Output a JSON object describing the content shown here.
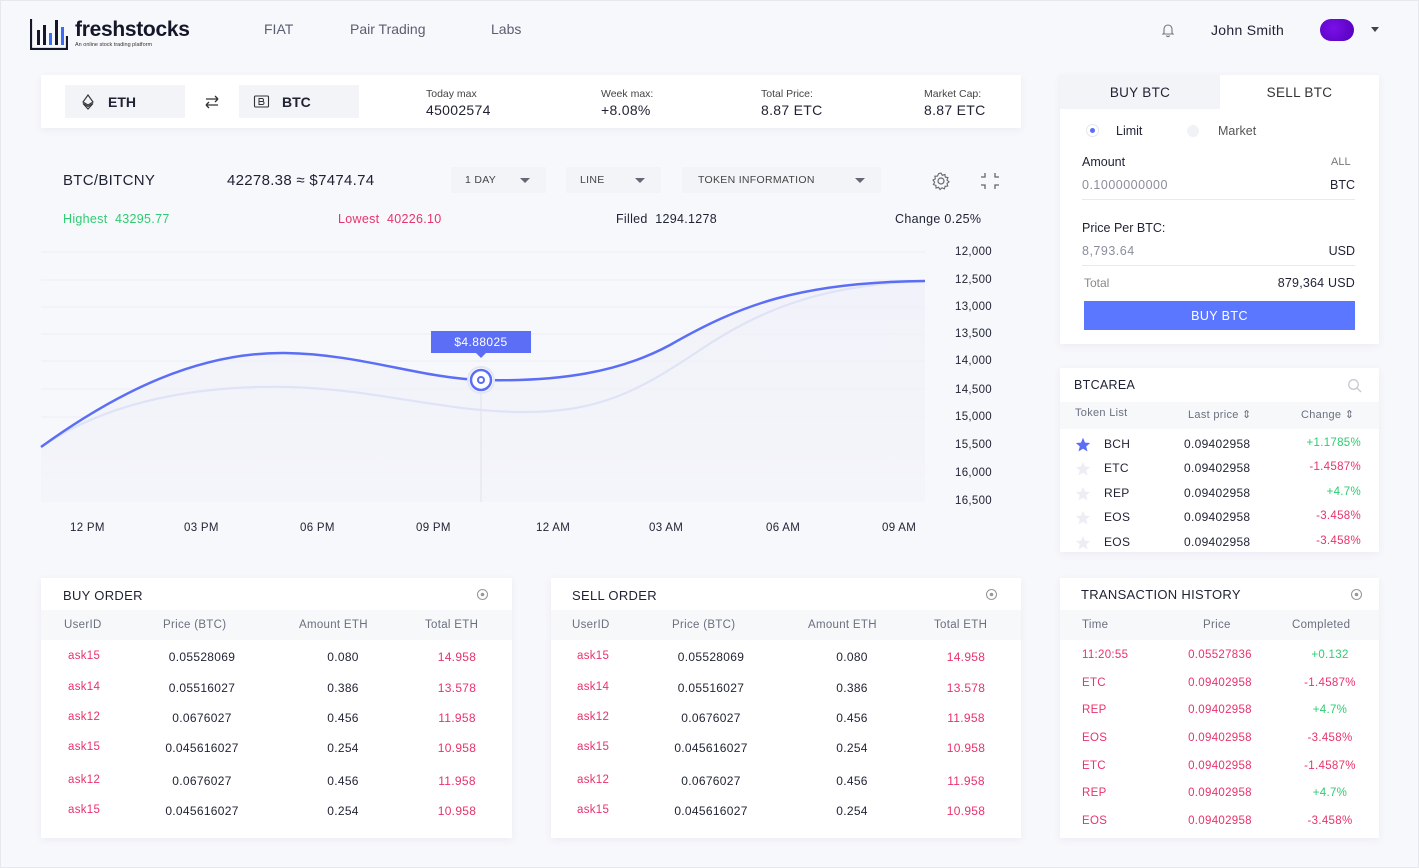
{
  "brand": {
    "name": "freshstocks",
    "tagline": "An online stock trading platform"
  },
  "nav": [
    "FIAT",
    "Pair Trading",
    "Labs"
  ],
  "user": {
    "name": "John Smith"
  },
  "pair": {
    "from": "ETH",
    "to": "BTC"
  },
  "stats": [
    {
      "label": "Today max",
      "value": "45002574",
      "positive": false
    },
    {
      "label": "Week max:",
      "value": "+8.08%",
      "positive": true
    },
    {
      "label": "Total Price:",
      "value": "8.87 ETC",
      "positive": false
    },
    {
      "label": "Market Cap:",
      "value": "8.87 ETC",
      "positive": false
    }
  ],
  "chart_panel": {
    "pair": "BTC/BITCNY",
    "price": "42278.38 ≈ $7474.74",
    "dropdowns": [
      "1 DAY",
      "LINE",
      "TOKEN INFORMATION"
    ],
    "highest_label": "Highest",
    "highest_value": "43295.77",
    "lowest_label": "Lowest",
    "lowest_value": "40226.10",
    "filled_label": "Filled",
    "filled_value": "1294.1278",
    "change": "Change 0.25%",
    "tooltip": "$4.88025"
  },
  "chart_data": {
    "type": "line",
    "x": [
      "12 PM",
      "03 PM",
      "06 PM",
      "09 PM",
      "12 AM",
      "03 AM",
      "06 AM",
      "09 AM"
    ],
    "y_ticks": [
      "12,000",
      "12,500",
      "13,000",
      "13,500",
      "14,000",
      "14,500",
      "15,000",
      "15,500",
      "16,000",
      "16,500"
    ],
    "grid": true
  },
  "trade": {
    "tabs": [
      "BUY BTC",
      "SELL BTC"
    ],
    "order_types": [
      "Limit",
      "Market"
    ],
    "amount_label": "Amount",
    "all_label": "ALL",
    "amount_placeholder": "0.1000000000",
    "amount_unit": "BTC",
    "price_label": "Price Per BTC:",
    "price_placeholder": "8,793.64",
    "price_unit": "USD",
    "total_label": "Total",
    "total_value": "879,364 USD",
    "submit": "BUY BTC"
  },
  "area": {
    "title": "BTCAREA",
    "headers": [
      "Token List",
      "Last price ⇕",
      "Change ⇕"
    ],
    "rows": [
      {
        "token": "BCH",
        "price": "0.09402958",
        "change": "+1.1785%",
        "up": true,
        "starred": true
      },
      {
        "token": "ETC",
        "price": "0.09402958",
        "change": "-1.4587%",
        "up": false,
        "starred": false
      },
      {
        "token": "REP",
        "price": "0.09402958",
        "change": "+4.7%",
        "up": true,
        "starred": false
      },
      {
        "token": "EOS",
        "price": "0.09402958",
        "change": "-3.458%",
        "up": false,
        "starred": false
      },
      {
        "token": "EOS",
        "price": "0.09402958",
        "change": "-3.458%",
        "up": false,
        "starred": false
      }
    ]
  },
  "buy_order": {
    "title": "BUY ORDER",
    "headers": [
      "UserID",
      "Price (BTC)",
      "Amount ETH",
      "Total ETH"
    ],
    "rows": [
      [
        "ask15",
        "0.05528069",
        "0.080",
        "14.958"
      ],
      [
        "ask14",
        "0.05516027",
        "0.386",
        "13.578"
      ],
      [
        "ask12",
        "0.0676027",
        "0.456",
        "11.958"
      ],
      [
        "ask15",
        "0.045616027",
        "0.254",
        "10.958"
      ],
      [
        "ask12",
        "0.0676027",
        "0.456",
        "11.958"
      ],
      [
        "ask15",
        "0.045616027",
        "0.254",
        "10.958"
      ]
    ]
  },
  "sell_order": {
    "title": "SELL ORDER",
    "headers": [
      "UserID",
      "Price (BTC)",
      "Amount ETH",
      "Total ETH"
    ],
    "rows": [
      [
        "ask15",
        "0.05528069",
        "0.080",
        "14.958"
      ],
      [
        "ask14",
        "0.05516027",
        "0.386",
        "13.578"
      ],
      [
        "ask12",
        "0.0676027",
        "0.456",
        "11.958"
      ],
      [
        "ask15",
        "0.045616027",
        "0.254",
        "10.958"
      ],
      [
        "ask12",
        "0.0676027",
        "0.456",
        "11.958"
      ],
      [
        "ask15",
        "0.045616027",
        "0.254",
        "10.958"
      ]
    ]
  },
  "history": {
    "title": "TRANSACTION HISTORY",
    "headers": [
      "Time",
      "Price",
      "Completed"
    ],
    "rows": [
      {
        "time": "11:20:55",
        "price": "0.05527836",
        "completed": "+0.132",
        "up": true
      },
      {
        "time": "ETC",
        "price": "0.09402958",
        "completed": "-1.4587%",
        "up": false
      },
      {
        "time": "REP",
        "price": "0.09402958",
        "completed": "+4.7%",
        "up": true
      },
      {
        "time": "EOS",
        "price": "0.09402958",
        "completed": "-3.458%",
        "up": false
      },
      {
        "time": "ETC",
        "price": "0.09402958",
        "completed": "-1.4587%",
        "up": false
      },
      {
        "time": "REP",
        "price": "0.09402958",
        "completed": "+4.7%",
        "up": true
      },
      {
        "time": "EOS",
        "price": "0.09402958",
        "completed": "-3.458%",
        "up": false
      }
    ]
  },
  "colors": {
    "accent": "#5b6ef5",
    "positive": "#2ecc71",
    "negative": "#e8336b"
  }
}
